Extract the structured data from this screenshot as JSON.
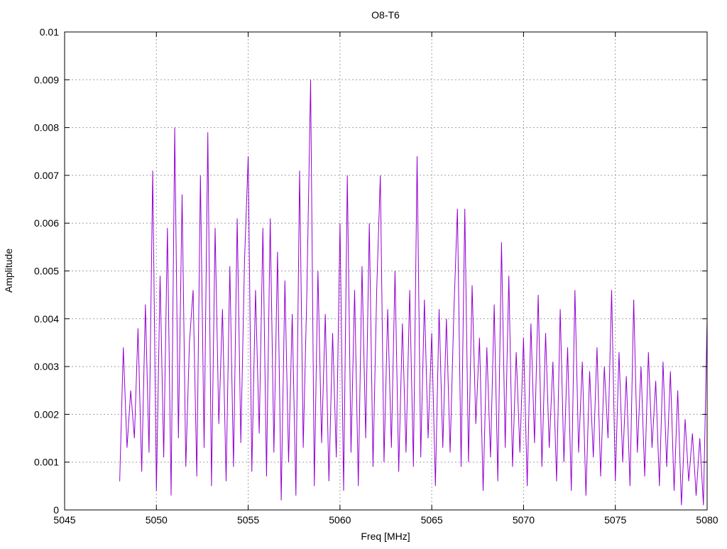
{
  "chart_data": {
    "type": "line",
    "title": "O8-T6",
    "xlabel": "Freq [MHz]",
    "ylabel": "Amplitude",
    "xlim": [
      5045,
      5080
    ],
    "ylim": [
      0,
      0.01
    ],
    "grid": true,
    "legend": "none",
    "xticks": [
      "5045",
      "5050",
      "5055",
      "5060",
      "5065",
      "5070",
      "5075",
      "5080"
    ],
    "yticks": [
      "0",
      "0.001",
      "0.002",
      "0.003",
      "0.004",
      "0.005",
      "0.006",
      "0.007",
      "0.008",
      "0.009",
      "0.01"
    ],
    "series": [
      {
        "name": "O8-T6",
        "color": "#9400d3",
        "x_start": 5048.0,
        "x_step": 0.2,
        "y_scale": 0.001,
        "values": [
          0.6,
          3.4,
          1.3,
          2.5,
          1.5,
          3.8,
          0.8,
          4.3,
          1.2,
          7.1,
          0.4,
          4.9,
          1.1,
          5.9,
          0.3,
          8.0,
          1.5,
          6.6,
          0.9,
          3.5,
          4.6,
          0.7,
          7.0,
          1.3,
          7.9,
          0.5,
          5.9,
          1.8,
          4.2,
          0.6,
          5.1,
          0.9,
          6.1,
          1.4,
          5.2,
          7.4,
          0.8,
          4.6,
          1.6,
          5.9,
          0.7,
          6.1,
          1.2,
          5.4,
          0.2,
          4.8,
          1.0,
          4.1,
          0.3,
          7.1,
          1.3,
          4.6,
          9.0,
          0.5,
          5.0,
          1.4,
          4.1,
          0.6,
          3.7,
          1.1,
          6.0,
          0.4,
          7.0,
          1.2,
          4.6,
          0.5,
          5.1,
          1.5,
          6.0,
          0.9,
          4.6,
          7.0,
          1.0,
          4.2,
          1.3,
          5.0,
          0.8,
          3.9,
          1.2,
          4.6,
          0.9,
          7.4,
          1.1,
          4.4,
          1.5,
          3.7,
          0.5,
          4.2,
          1.3,
          4.0,
          1.2,
          4.1,
          6.3,
          0.9,
          6.3,
          1.0,
          4.7,
          1.8,
          3.6,
          0.4,
          3.4,
          1.1,
          4.3,
          0.6,
          5.6,
          1.3,
          4.9,
          0.9,
          3.3,
          1.2,
          3.6,
          0.5,
          3.9,
          1.4,
          4.5,
          0.9,
          3.7,
          1.3,
          3.1,
          0.6,
          4.2,
          1.0,
          3.4,
          0.4,
          4.6,
          1.2,
          3.1,
          0.3,
          2.9,
          1.1,
          3.4,
          0.7,
          3.0,
          1.5,
          4.6,
          0.6,
          3.3,
          1.0,
          2.8,
          0.5,
          4.4,
          1.2,
          3.0,
          0.7,
          3.3,
          1.3,
          2.7,
          0.5,
          3.1,
          0.9,
          2.9,
          0.4,
          2.5,
          0.1,
          1.9,
          0.6,
          1.6,
          0.3,
          1.5,
          0.1,
          4.0
        ]
      }
    ]
  }
}
